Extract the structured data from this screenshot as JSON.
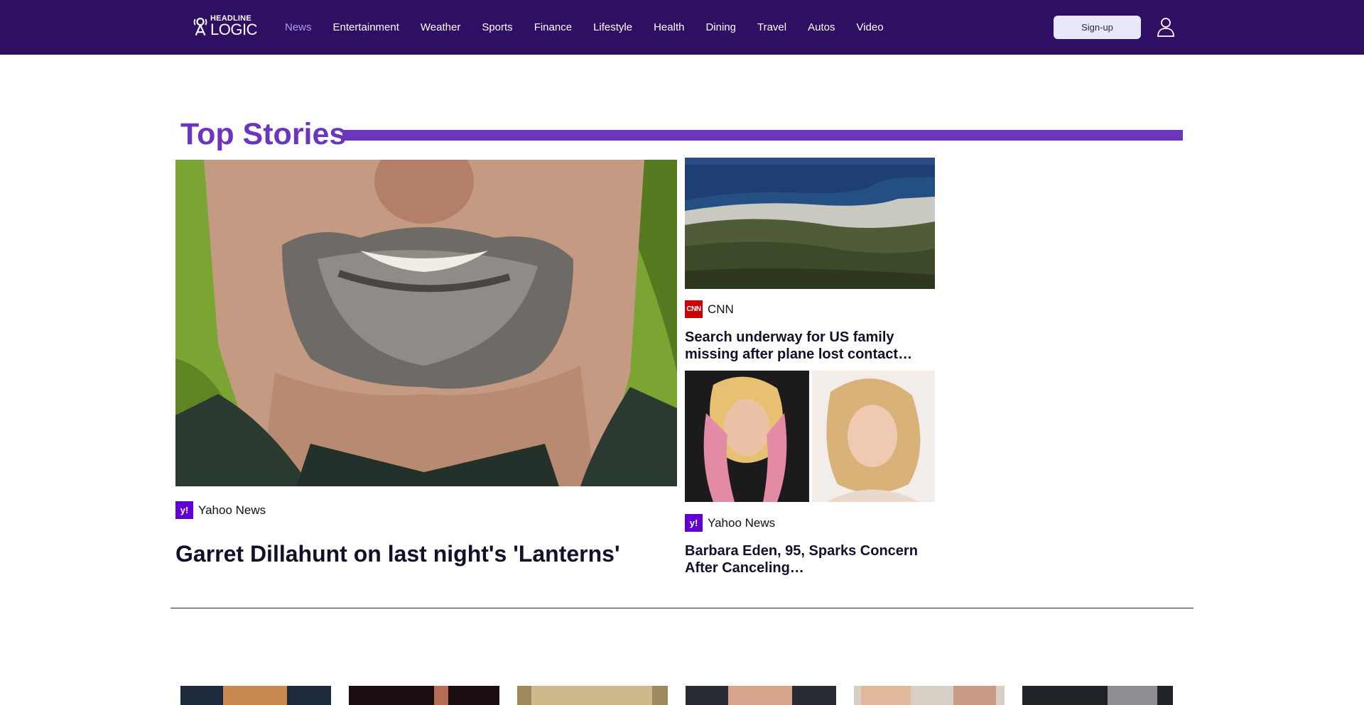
{
  "header": {
    "logo": {
      "top": "HEADLINE",
      "bottom": "LOGIC"
    },
    "nav": [
      {
        "label": "News",
        "active": true
      },
      {
        "label": "Entertainment",
        "active": false
      },
      {
        "label": "Weather",
        "active": false
      },
      {
        "label": "Sports",
        "active": false
      },
      {
        "label": "Finance",
        "active": false
      },
      {
        "label": "Lifestyle",
        "active": false
      },
      {
        "label": "Health",
        "active": false
      },
      {
        "label": "Dining",
        "active": false
      },
      {
        "label": "Travel",
        "active": false
      },
      {
        "label": "Autos",
        "active": false
      },
      {
        "label": "Video",
        "active": false
      }
    ],
    "signup_label": "Sign-up",
    "user_icon": "user-icon"
  },
  "top_stories": {
    "title": "Top Stories",
    "hero": {
      "source": "Yahoo News",
      "source_icon": "yahoo-logo",
      "headline": "Garret Dillahunt on last night's 'Lanterns'"
    },
    "cards": [
      {
        "source": "CNN",
        "source_icon": "cnn-logo",
        "headline": "Search underway for US family missing after plane lost contact…"
      },
      {
        "source": "Yahoo News",
        "source_icon": "yahoo-logo",
        "headline": "Barbara Eden, 95, Sparks Concern After Canceling…"
      }
    ]
  },
  "colors": {
    "brand": "#2e0f63",
    "accent": "#6c35be",
    "active_nav": "#b39cf0"
  }
}
